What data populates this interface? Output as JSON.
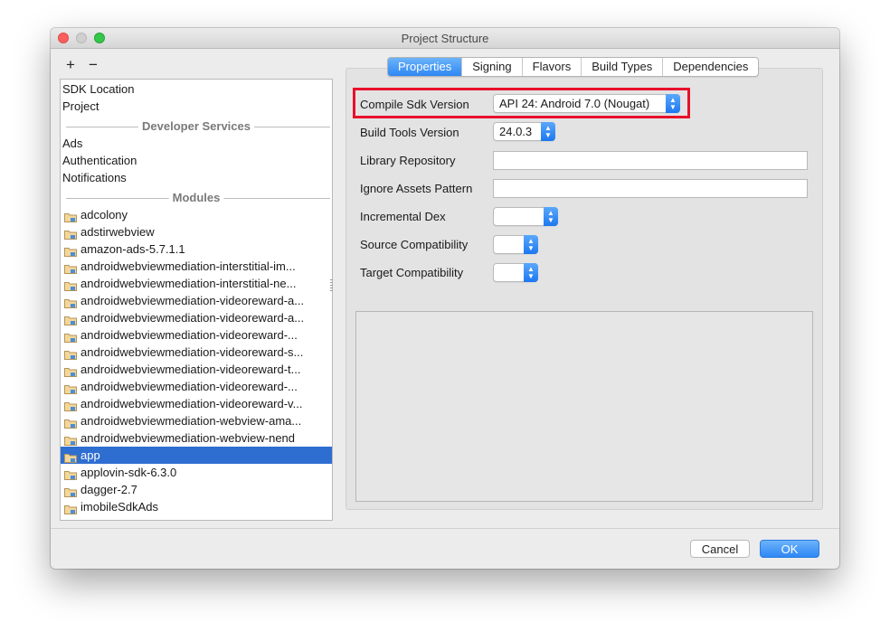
{
  "window": {
    "title": "Project Structure"
  },
  "toolbar": {
    "add_label": "+",
    "remove_label": "−"
  },
  "sidebar": {
    "top_items": [
      "SDK Location",
      "Project"
    ],
    "developer_services_header": "Developer Services",
    "services": [
      "Ads",
      "Authentication",
      "Notifications"
    ],
    "modules_header": "Modules",
    "modules": [
      "adcolony",
      "adstirwebview",
      "amazon-ads-5.7.1.1",
      "androidwebviewmediation-interstitial-im...",
      "androidwebviewmediation-interstitial-ne...",
      "androidwebviewmediation-videoreward-a...",
      "androidwebviewmediation-videoreward-a...",
      "androidwebviewmediation-videoreward-...",
      "androidwebviewmediation-videoreward-s...",
      "androidwebviewmediation-videoreward-t...",
      "androidwebviewmediation-videoreward-...",
      "androidwebviewmediation-videoreward-v...",
      "androidwebviewmediation-webview-ama...",
      "androidwebviewmediation-webview-nend",
      "app",
      "applovin-sdk-6.3.0",
      "dagger-2.7",
      "imobileSdkAds"
    ],
    "selected_module": "app"
  },
  "tabs": [
    "Properties",
    "Signing",
    "Flavors",
    "Build Types",
    "Dependencies"
  ],
  "active_tab": "Properties",
  "form": {
    "compile_sdk_label": "Compile Sdk Version",
    "compile_sdk_value": "API 24: Android 7.0 (Nougat)",
    "build_tools_label": "Build Tools Version",
    "build_tools_value": "24.0.3",
    "library_repo_label": "Library Repository",
    "library_repo_value": "",
    "ignore_assets_label": "Ignore Assets Pattern",
    "ignore_assets_value": "",
    "incremental_dex_label": "Incremental Dex",
    "incremental_dex_value": "",
    "source_compat_label": "Source Compatibility",
    "source_compat_value": "",
    "target_compat_label": "Target Compatibility",
    "target_compat_value": ""
  },
  "buttons": {
    "cancel": "Cancel",
    "ok": "OK"
  },
  "colors": {
    "highlight": "#e8102b",
    "accent": "#2f6ed1"
  }
}
